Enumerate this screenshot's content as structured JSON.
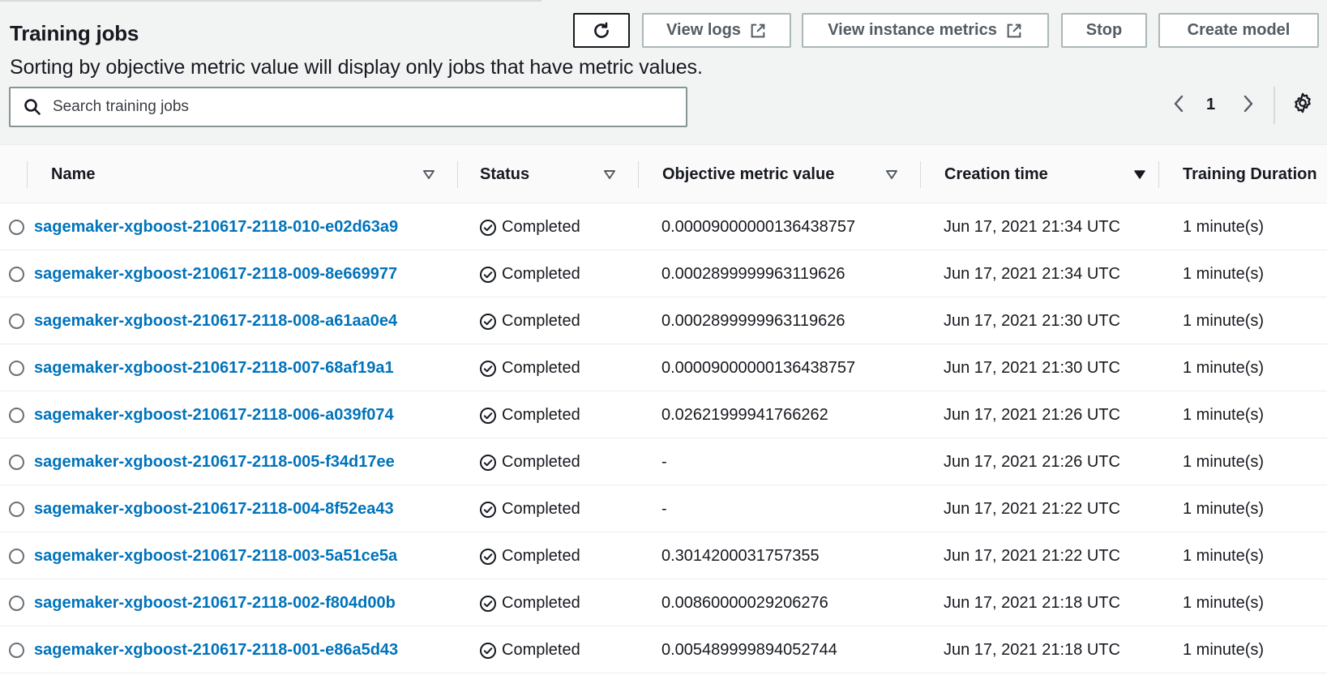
{
  "page": {
    "title": "Training jobs",
    "subtitle": "Sorting by objective metric value will display only jobs that have metric values."
  },
  "toolbar": {
    "refresh_icon": "refresh-icon",
    "view_logs_label": "View logs",
    "view_instance_metrics_label": "View instance metrics",
    "stop_label": "Stop",
    "create_model_label": "Create model",
    "external_link_icon": "external-link-icon"
  },
  "search": {
    "placeholder": "Search training jobs",
    "value": ""
  },
  "pagination": {
    "current_page": "1"
  },
  "table": {
    "columns": {
      "name": "Name",
      "status": "Status",
      "objective_metric_value": "Objective metric value",
      "creation_time": "Creation time",
      "training_duration": "Training Duration"
    },
    "sorted_column": "Creation time",
    "rows": [
      {
        "name": "sagemaker-xgboost-210617-2118-010-e02d63a9",
        "status": "Completed",
        "metric": "0.00009000000136438757",
        "created": "Jun 17, 2021 21:34 UTC",
        "duration": "1 minute(s)"
      },
      {
        "name": "sagemaker-xgboost-210617-2118-009-8e669977",
        "status": "Completed",
        "metric": "0.0002899999963119626",
        "created": "Jun 17, 2021 21:34 UTC",
        "duration": "1 minute(s)"
      },
      {
        "name": "sagemaker-xgboost-210617-2118-008-a61aa0e4",
        "status": "Completed",
        "metric": "0.0002899999963119626",
        "created": "Jun 17, 2021 21:30 UTC",
        "duration": "1 minute(s)"
      },
      {
        "name": "sagemaker-xgboost-210617-2118-007-68af19a1",
        "status": "Completed",
        "metric": "0.00009000000136438757",
        "created": "Jun 17, 2021 21:30 UTC",
        "duration": "1 minute(s)"
      },
      {
        "name": "sagemaker-xgboost-210617-2118-006-a039f074",
        "status": "Completed",
        "metric": "0.02621999941766262",
        "created": "Jun 17, 2021 21:26 UTC",
        "duration": "1 minute(s)"
      },
      {
        "name": "sagemaker-xgboost-210617-2118-005-f34d17ee",
        "status": "Completed",
        "metric": "-",
        "created": "Jun 17, 2021 21:26 UTC",
        "duration": "1 minute(s)"
      },
      {
        "name": "sagemaker-xgboost-210617-2118-004-8f52ea43",
        "status": "Completed",
        "metric": "-",
        "created": "Jun 17, 2021 21:22 UTC",
        "duration": "1 minute(s)"
      },
      {
        "name": "sagemaker-xgboost-210617-2118-003-5a51ce5a",
        "status": "Completed",
        "metric": "0.3014200031757355",
        "created": "Jun 17, 2021 21:22 UTC",
        "duration": "1 minute(s)"
      },
      {
        "name": "sagemaker-xgboost-210617-2118-002-f804d00b",
        "status": "Completed",
        "metric": "0.00860000029206276",
        "created": "Jun 17, 2021 21:18 UTC",
        "duration": "1 minute(s)"
      },
      {
        "name": "sagemaker-xgboost-210617-2118-001-e86a5d43",
        "status": "Completed",
        "metric": "0.005489999894052744",
        "created": "Jun 17, 2021 21:18 UTC",
        "duration": "1 minute(s)"
      }
    ]
  },
  "colors": {
    "link": "#0073bb",
    "header_background": "#f2f3f3",
    "text": "#16191f"
  }
}
